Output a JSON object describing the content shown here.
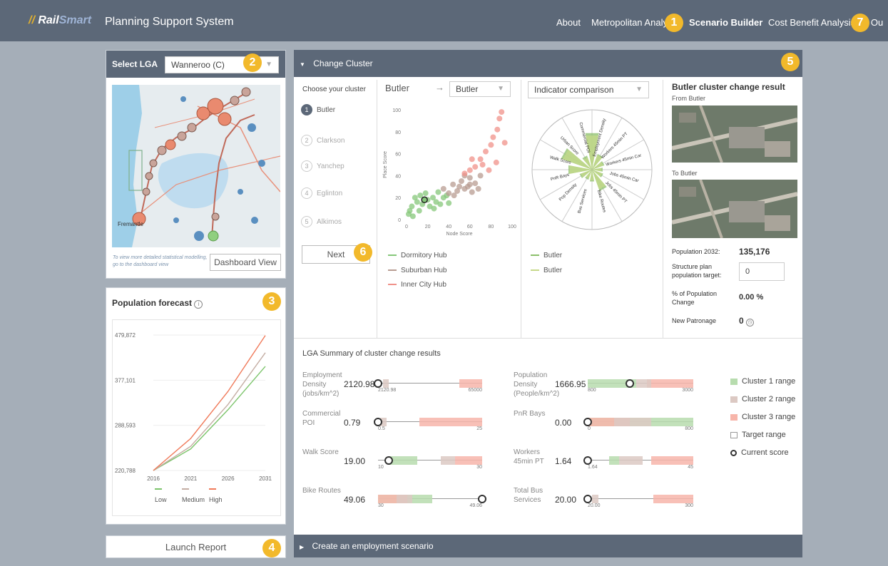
{
  "brand": {
    "mark": "//",
    "rail": "Rail",
    "smart": "Smart",
    "title": "Planning Support System"
  },
  "nav": {
    "about": "About",
    "metro": "Metropolitan Analy",
    "scenario": "Scenario Builder",
    "cba": "Cost Benefit Analysis",
    "logout": "g Ou"
  },
  "badges": [
    "1",
    "2",
    "3",
    "4",
    "5",
    "6",
    "7"
  ],
  "lga": {
    "label": "Select LGA",
    "value": "Wanneroo (C)",
    "hint": "To view more detailed statistical modelling, go to the dashboard view",
    "dashboard_button": "Dashboard View",
    "map_label": "Fremantle"
  },
  "forecast": {
    "title": "Population forecast",
    "chart_data": {
      "type": "line",
      "x": [
        2016,
        2021,
        2026,
        2031
      ],
      "xticks": [
        "2016",
        "2021",
        "2026",
        "2031"
      ],
      "yticks": [
        "220,788",
        "288,593",
        "377,101",
        "479,872"
      ],
      "ylim": [
        220788,
        479872
      ],
      "series": [
        {
          "name": "Low",
          "color": "#7cc46b",
          "values": [
            220788,
            262000,
            337000,
            420000
          ]
        },
        {
          "name": "Medium",
          "color": "#c4ada3",
          "values": [
            220788,
            267000,
            347000,
            446000
          ]
        },
        {
          "name": "High",
          "color": "#f07a5a",
          "values": [
            220788,
            282000,
            372000,
            479000
          ]
        }
      ]
    }
  },
  "launch_report": "Launch Report",
  "change_cluster": {
    "header": "Change Cluster",
    "choose_label": "Choose your cluster",
    "clusters": [
      {
        "num": "1",
        "name": "Butler"
      },
      {
        "num": "2",
        "name": "Clarkson"
      },
      {
        "num": "3",
        "name": "Yanchep"
      },
      {
        "num": "4",
        "name": "Eglinton"
      },
      {
        "num": "5",
        "name": "Alkimos"
      }
    ],
    "next_button": "Next",
    "from_station": "Butler",
    "arrow": "→",
    "to_station": "Butler",
    "scatter": {
      "chart_data": {
        "type": "scatter",
        "xlabel": "Node Score",
        "ylabel": "Place Score",
        "xlim": [
          0,
          100
        ],
        "ylim": [
          0,
          100
        ],
        "xticks": [
          "0",
          "20",
          "40",
          "60",
          "80",
          "100"
        ],
        "yticks": [
          "0",
          "20",
          "40",
          "60",
          "80",
          "100"
        ],
        "highlight": {
          "x": 17,
          "y": 18
        },
        "series": [
          {
            "name": "Dormitory Hub",
            "color": "#86c77a",
            "points": [
              [
                2,
                5
              ],
              [
                3,
                8
              ],
              [
                5,
                12
              ],
              [
                8,
                20
              ],
              [
                10,
                16
              ],
              [
                13,
                22
              ],
              [
                15,
                14
              ],
              [
                18,
                24
              ],
              [
                20,
                18
              ],
              [
                22,
                12
              ],
              [
                25,
                20
              ],
              [
                28,
                16
              ],
              [
                30,
                25
              ],
              [
                32,
                14
              ],
              [
                35,
                20
              ],
              [
                38,
                22
              ],
              [
                40,
                15
              ],
              [
                26,
                10
              ],
              [
                12,
                8
              ],
              [
                6,
                3
              ]
            ]
          },
          {
            "name": "Suburban Hub",
            "color": "#b89c92",
            "points": [
              [
                35,
                28
              ],
              [
                40,
                24
              ],
              [
                44,
                32
              ],
              [
                48,
                26
              ],
              [
                52,
                35
              ],
              [
                55,
                28
              ],
              [
                58,
                30
              ],
              [
                60,
                38
              ],
              [
                62,
                25
              ],
              [
                65,
                33
              ],
              [
                68,
                28
              ],
              [
                70,
                40
              ],
              [
                55,
                40
              ],
              [
                45,
                22
              ],
              [
                50,
                30
              ],
              [
                60,
                32
              ]
            ]
          },
          {
            "name": "Inner City Hub",
            "color": "#f0928a",
            "points": [
              [
                55,
                42
              ],
              [
                60,
                45
              ],
              [
                65,
                48
              ],
              [
                70,
                55
              ],
              [
                75,
                62
              ],
              [
                80,
                68
              ],
              [
                82,
                75
              ],
              [
                86,
                82
              ],
              [
                88,
                92
              ],
              [
                90,
                98
              ],
              [
                93,
                70
              ],
              [
                85,
                52
              ],
              [
                78,
                45
              ],
              [
                72,
                50
              ],
              [
                62,
                55
              ]
            ]
          }
        ]
      }
    },
    "indicator_select": "Indicator comparison",
    "radar": {
      "chart_data": {
        "type": "radar",
        "axes": [
          "Employment Density",
          "Workers 45min PT",
          "Workers 45min Car",
          "Jobs 45min Car",
          "Jobs 45min PT",
          "Bike Routes",
          "Bus Services",
          "Pop Density",
          "PnR Bays",
          "Walk Score",
          "Urban Score",
          "Commercial POI"
        ],
        "series": [
          {
            "name": "Butler",
            "color": "#8bbf6a",
            "values": [
              0.62,
              0.28,
              0.22,
              0.18,
              0.2,
              0.38,
              0.2,
              0.18,
              0.22,
              0.4,
              0.55,
              0.25
            ]
          },
          {
            "name": "Butler",
            "color": "#c6d98a",
            "values": [
              0.58,
              0.26,
              0.2,
              0.16,
              0.18,
              0.35,
              0.18,
              0.16,
              0.2,
              0.38,
              0.52,
              0.22
            ]
          }
        ]
      }
    },
    "result": {
      "title": "Butler cluster change result",
      "from_label": "From Butler",
      "to_label": "To Butler",
      "pop_label": "Population 2032:",
      "pop_value": "135,176",
      "target_label": "Structure plan population target:",
      "target_value": "0",
      "change_label": "% of Population Change",
      "change_value": "0.00 %",
      "patronage_label": "New Patronage",
      "patronage_value": "0"
    }
  },
  "summary": {
    "title": "LGA Summary of cluster change results",
    "rows_left": [
      {
        "label": "Employment Density (jobs/km^2)",
        "value": "2120.98",
        "lo": "2120.98",
        "hi": "65000",
        "current": 0.0,
        "c1": [
          0.0,
          0.0
        ],
        "c2": [
          0.05,
          0.1
        ],
        "c3": [
          0.78,
          1.0
        ]
      },
      {
        "label": "Commercial POI",
        "value": "0.79",
        "lo": "0.5",
        "hi": "25",
        "current": 0.0,
        "c1": [
          0.0,
          0.0
        ],
        "c2": [
          0.02,
          0.08
        ],
        "c3": [
          0.4,
          1.0
        ]
      },
      {
        "label": "Walk Score",
        "value": "19.00",
        "lo": "10",
        "hi": "30",
        "current": 0.1,
        "c1": [
          0.1,
          0.38
        ],
        "c2": [
          0.6,
          0.74
        ],
        "c3": [
          0.74,
          1.0
        ]
      },
      {
        "label": "Bike Routes",
        "value": "49.06",
        "lo": "30",
        "hi": "49.06",
        "current": 1.0,
        "c1": [
          0.0,
          0.52
        ],
        "c2": [
          0.18,
          0.33
        ],
        "c3": [
          0.0,
          0.28
        ]
      }
    ],
    "rows_right": [
      {
        "label": "Population Density (People/km^2)",
        "value": "1666.95",
        "lo": "800",
        "hi": "3000",
        "current": 0.4,
        "c1": [
          0.0,
          0.46
        ],
        "c2": [
          0.46,
          0.6
        ],
        "c3": [
          0.56,
          1.0
        ]
      },
      {
        "label": "PnR Bays",
        "value": "0.00",
        "lo": "0",
        "hi": "800",
        "current": 0.0,
        "c1": [
          0.0,
          1.0
        ],
        "c2": [
          0.25,
          0.6
        ],
        "c3": [
          0.0,
          0.4
        ]
      },
      {
        "label": "Workers 45min PT",
        "value": "1.64",
        "lo": "1.64",
        "hi": "45",
        "current": 0.0,
        "c1": [
          0.2,
          0.3
        ],
        "c2": [
          0.3,
          0.52
        ],
        "c3": [
          0.6,
          1.0
        ]
      },
      {
        "label": "Total Bus Services",
        "value": "20.00",
        "lo": "20.00",
        "hi": "300",
        "current": 0.0,
        "c1": [
          0.0,
          0.0
        ],
        "c2": [
          0.04,
          0.1
        ],
        "c3": [
          0.62,
          1.0
        ]
      }
    ],
    "legend": [
      {
        "label": "Cluster 1 range",
        "color": "#b7dcae"
      },
      {
        "label": "Cluster 2 range",
        "color": "#dcc9c3"
      },
      {
        "label": "Cluster 3 range",
        "color": "#f7b5aa"
      },
      {
        "label": "Target range",
        "color": "#ffffff"
      },
      {
        "label": "Current score",
        "color": "#ffffff"
      }
    ]
  },
  "employment_scenario": "Create an employment scenario",
  "colors": {
    "header": "#5c6878",
    "badge": "#f2b92b",
    "bg": "#a5aeb8"
  }
}
